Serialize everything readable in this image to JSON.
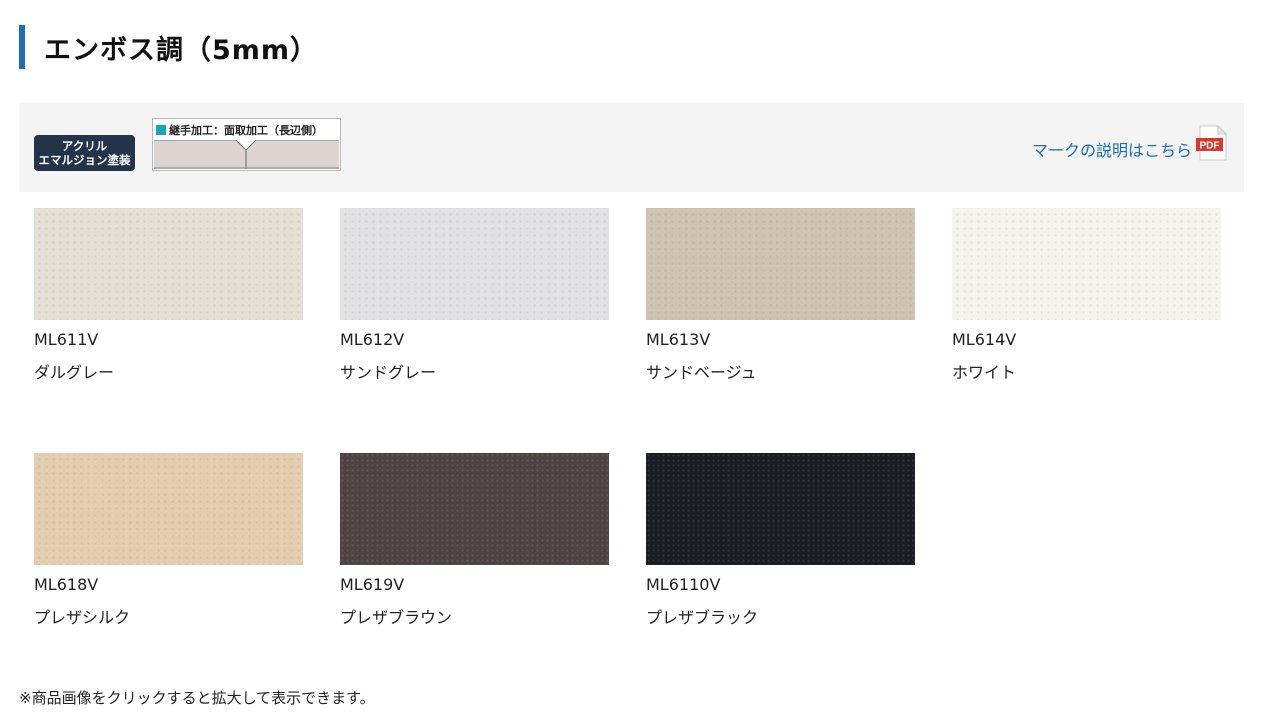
{
  "section": {
    "title": "エンボス調（5mm）",
    "accent_color": "#1a6fb5"
  },
  "mark_bar": {
    "badge_line1": "アクリル",
    "badge_line2": "エマルジョン塗装",
    "badge_color": "#23344a",
    "joint_label": "継手加工：面取加工（長辺側）",
    "joint_marker_color": "#17a7b3",
    "pdf_link_text": "マークの説明はこちら",
    "pdf_icon_label": "PDF",
    "pdf_icon": "pdf-file-icon"
  },
  "swatches": [
    {
      "code": "ML611V",
      "name": "ダルグレー",
      "color": "#e3dfd4"
    },
    {
      "code": "ML612V",
      "name": "サンドグレー",
      "color": "#e1e1e3"
    },
    {
      "code": "ML613V",
      "name": "サンドベージュ",
      "color": "#cbc3b0"
    },
    {
      "code": "ML614V",
      "name": "ホワイト",
      "color": "#f5f3ee"
    },
    {
      "code": "ML618V",
      "name": "プレザシルク",
      "color": "#e4cdaf"
    },
    {
      "code": "ML619V",
      "name": "プレザブラウン",
      "color": "#4e4443"
    },
    {
      "code": "ML6110V",
      "name": "プレザブラック",
      "color": "#1b1d24"
    }
  ],
  "footnote": "※商品画像をクリックすると拡大して表示できます。"
}
